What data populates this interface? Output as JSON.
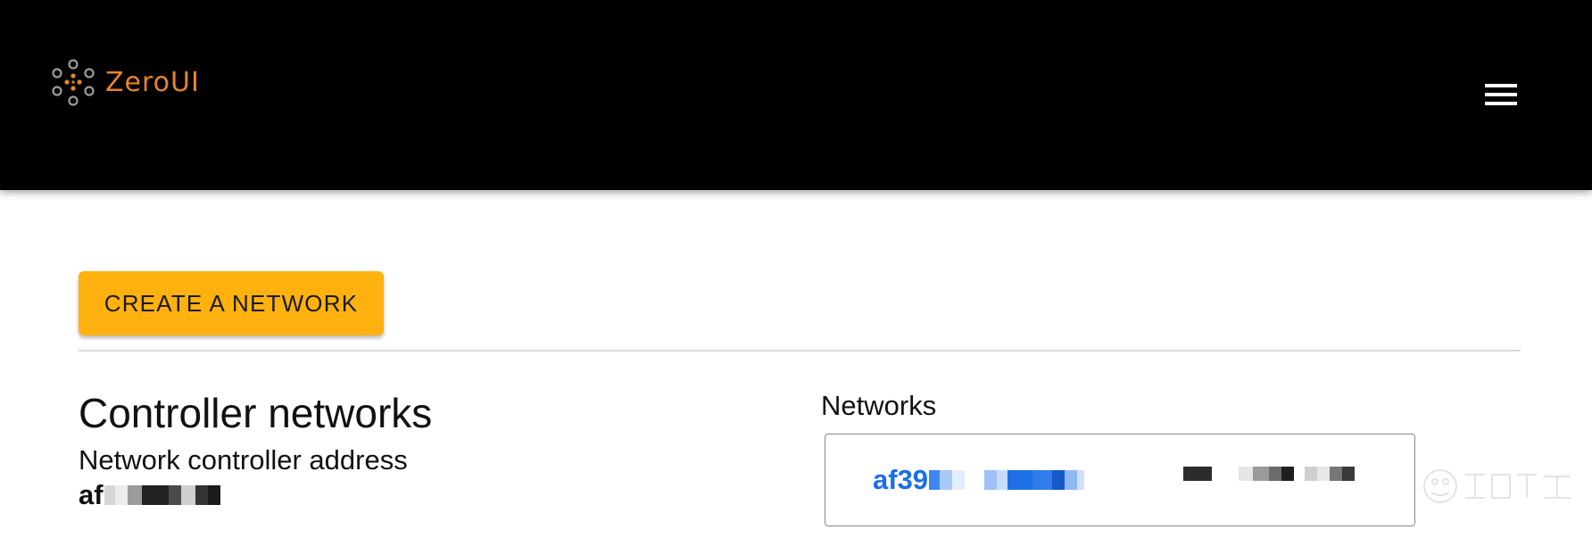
{
  "app": {
    "name": "ZeroUI",
    "brand_color": "#e8822b",
    "header_bg": "#000000"
  },
  "header": {
    "logo_icon": "zerotier-dots-logo-icon",
    "menu_icon": "hamburger-menu-icon"
  },
  "actions": {
    "create_network_label": "CREATE A NETWORK",
    "create_network_color": "#ffb20f"
  },
  "controller": {
    "title": "Controller networks",
    "address_label": "Network controller address",
    "address_value_visible": "af"
  },
  "networks": {
    "label": "Networks",
    "items": [
      {
        "id_visible": "af39",
        "link_color": "#1a6ee8"
      }
    ]
  }
}
